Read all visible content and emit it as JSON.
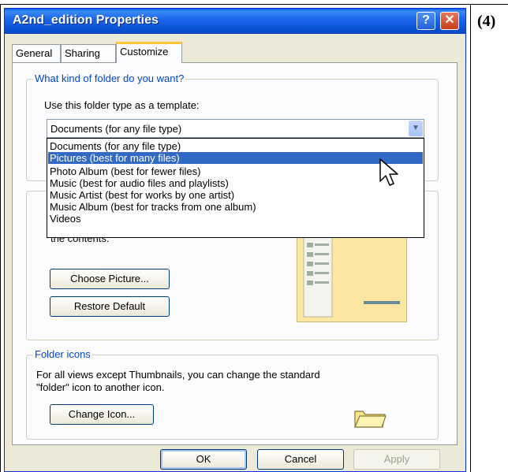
{
  "window": {
    "title": "A2nd_edition Properties",
    "help": "?",
    "close": "✕"
  },
  "step_label": "(4)",
  "tabs": [
    "General",
    "Sharing",
    "Customize"
  ],
  "folder_type": {
    "legend": "What kind of folder do you want?",
    "label": "Use this folder type as a template:",
    "selected": "Documents (for any file type)",
    "options": [
      "Documents (for any file type)",
      "Pictures (best for many files)",
      "Photo Album (best for fewer files)",
      "Music (best for audio files and playlists)",
      "Music Artist (best for works by one artist)",
      "Music Album (best for tracks from one album)",
      "Videos"
    ],
    "highlighted_option": "Pictures (best for many files)"
  },
  "folder_pictures": {
    "partial_text": "the contents.",
    "choose_label": "Choose Picture...",
    "restore_label": "Restore Default"
  },
  "folder_icons": {
    "legend": "Folder icons",
    "description_line1": "For all views except Thumbnails, you can change the standard",
    "description_line2": "\"folder\" icon to another icon.",
    "change_label": "Change Icon..."
  },
  "footer": {
    "ok": "OK",
    "cancel": "Cancel",
    "apply": "Apply"
  },
  "colors": {
    "titlebar": "#0a5de3",
    "highlight": "#316ac5",
    "dialog_bg": "#ece9d8"
  },
  "icons": [
    "help-icon",
    "close-icon",
    "dropdown-arrow-icon",
    "cursor-icon",
    "folder-icon"
  ]
}
